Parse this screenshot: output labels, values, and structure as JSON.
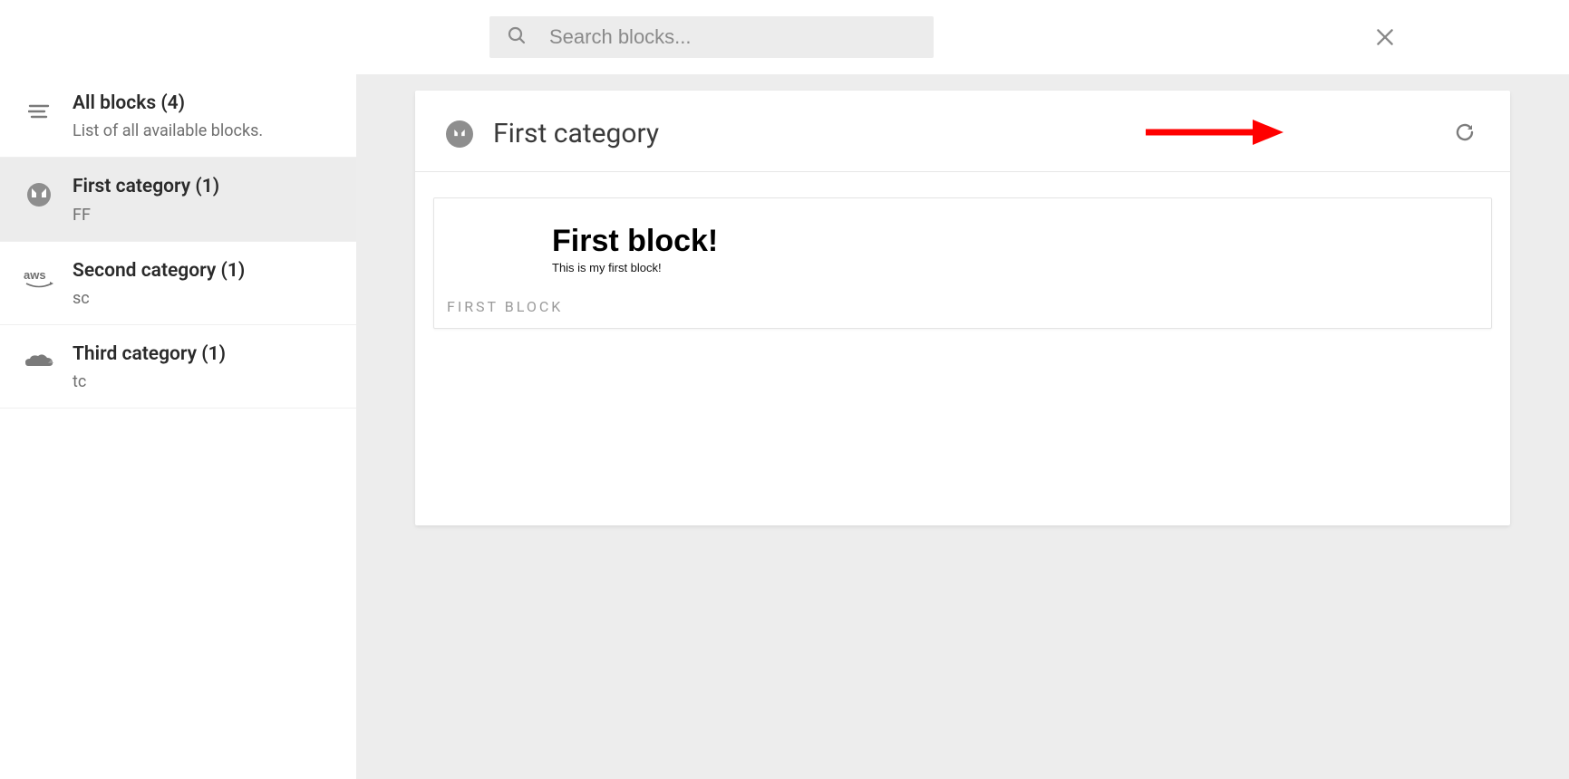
{
  "search": {
    "placeholder": "Search blocks..."
  },
  "sidebar": {
    "items": [
      {
        "title": "All blocks (4)",
        "sub": "List of all available blocks.",
        "icon": "lines"
      },
      {
        "title": "First category (1)",
        "sub": "FF",
        "icon": "monero",
        "selected": true
      },
      {
        "title": "Second category (1)",
        "sub": "sc",
        "icon": "aws"
      },
      {
        "title": "Third category (1)",
        "sub": "tc",
        "icon": "cloudflare"
      }
    ]
  },
  "panel": {
    "title": "First category",
    "blocks": [
      {
        "preview_heading": "First block!",
        "preview_text": "This is my first block!",
        "label": "FIRST BLOCK"
      }
    ]
  },
  "annotation": {
    "arrow_color": "#ff0000"
  }
}
